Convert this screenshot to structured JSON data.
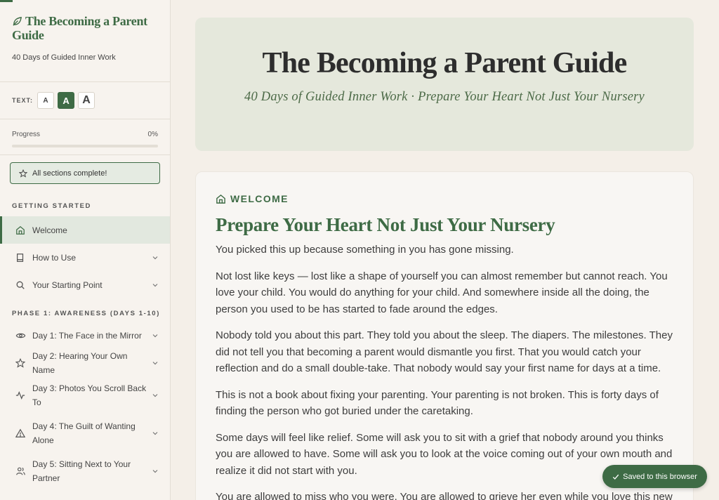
{
  "sidebar": {
    "brand_title": "The Becoming a Parent Guide",
    "brand_subtitle": "40 Days of Guided Inner Work",
    "text_label": "TEXT:",
    "text_sizes": [
      "A",
      "A",
      "A"
    ],
    "progress_label": "Progress",
    "progress_value": "0%",
    "progress_fraction": 0,
    "complete_label": "All sections complete!",
    "section_getting_started": "Getting Started",
    "section_phase1": "Phase 1: Awareness (Days 1-10)",
    "items": [
      {
        "label": "Welcome",
        "icon": "home-icon"
      },
      {
        "label": "How to Use",
        "icon": "book-icon"
      },
      {
        "label": "Your Starting Point",
        "icon": "search-icon"
      },
      {
        "label": "Day 1: The Face in the Mirror",
        "icon": "eye-icon"
      },
      {
        "label": "Day 2: Hearing Your Own Name",
        "icon": "star-icon"
      },
      {
        "label": "Day 3: Photos You Scroll Back To",
        "icon": "pulse-icon"
      },
      {
        "label": "Day 4: The Guilt of Wanting Alone",
        "icon": "warning-icon"
      },
      {
        "label": "Day 5: Sitting Next to Your Partner",
        "icon": "users-icon"
      }
    ]
  },
  "hero": {
    "title": "The Becoming a Parent Guide",
    "subtitle": "40 Days of Guided Inner Work · Prepare Your Heart Not Just Your Nursery"
  },
  "content": {
    "eyebrow": "WELCOME",
    "title": "Prepare Your Heart Not Just Your Nursery",
    "paragraphs": [
      "You picked this up because something in you has gone missing.",
      "Not lost like keys — lost like a shape of yourself you can almost remember but cannot reach. You love your child. You would do anything for your child. And somewhere inside all the doing, the person you used to be has started to fade around the edges.",
      "Nobody told you about this part. They told you about the sleep. The diapers. The milestones. They did not tell you that becoming a parent would dismantle you first. That you would catch your reflection and do a small double-take. That nobody would say your first name for days at a time.",
      "This is not a book about fixing your parenting. Your parenting is not broken. This is forty days of finding the person who got buried under the caretaking.",
      "Some days will feel like relief. Some will ask you to sit with a grief that nobody around you thinks you are allowed to have. Some will ask you to look at the voice coming out of your own mouth and realize it did not start with you.",
      "You are allowed to miss who you were. You are allowed to grieve her even while you love this new life."
    ]
  },
  "toast": "Saved to this browser",
  "colors": {
    "accent": "#3e6b45",
    "background": "#f4efe8",
    "hero": "#e5e8dc"
  }
}
